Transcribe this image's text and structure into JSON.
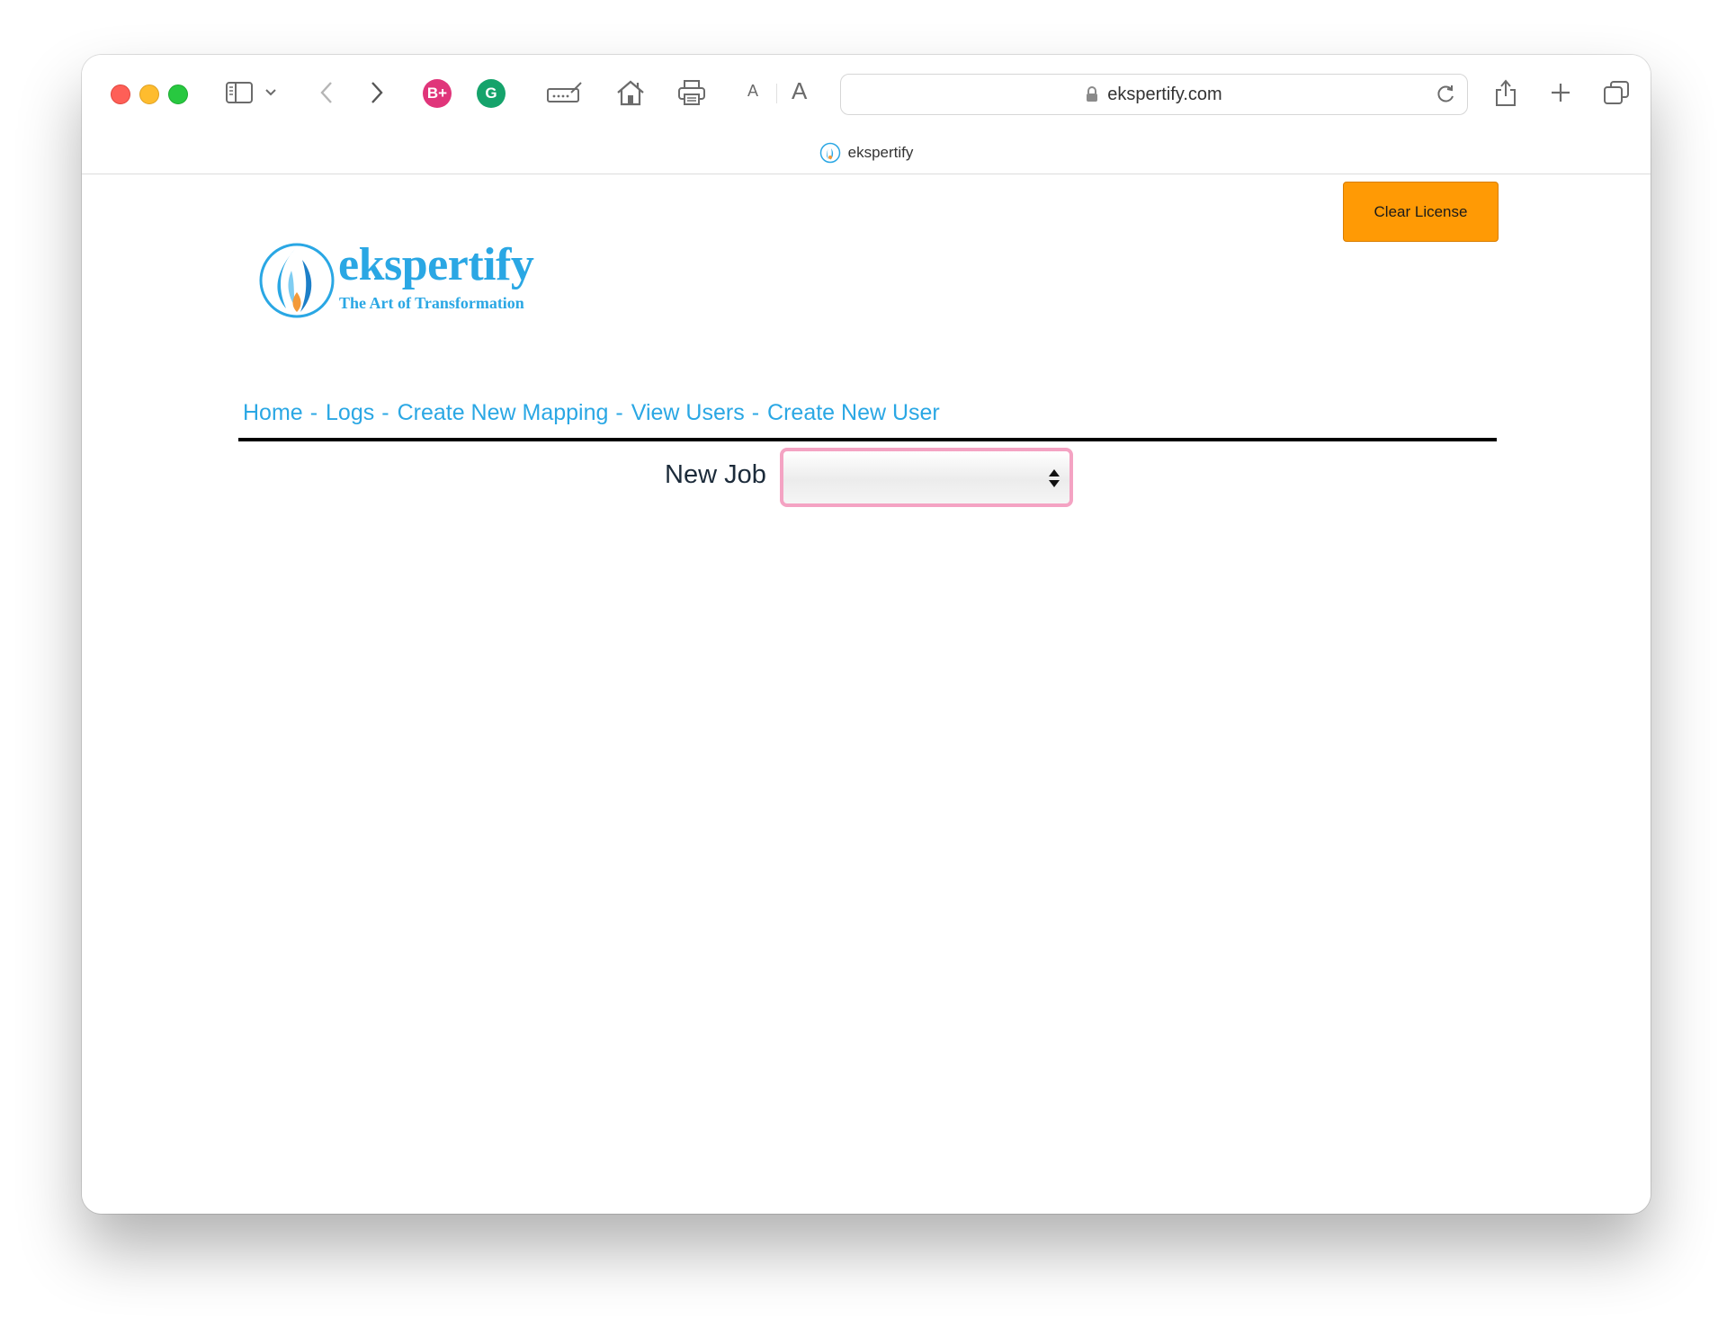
{
  "browser": {
    "url": "ekspertify.com",
    "tab_title": "ekspertify",
    "font_small_label": "A",
    "font_large_label": "A",
    "extensions": [
      {
        "name": "bplus-extension",
        "label": "B+",
        "color": "#e0357a"
      },
      {
        "name": "grammarly-extension",
        "label": "G",
        "color": "#15a36b"
      }
    ]
  },
  "page": {
    "clear_license_label": "Clear License",
    "logo": {
      "wordmark": "ekspertify",
      "tagline": "The Art of Transformation",
      "brand_color": "#2aa7e4",
      "flame_accent": "#f39a3a"
    },
    "nav": [
      {
        "label": "Home"
      },
      {
        "label": "Logs"
      },
      {
        "label": "Create New Mapping"
      },
      {
        "label": "View Users"
      },
      {
        "label": "Create New User"
      }
    ],
    "nav_separator": "-",
    "new_job": {
      "label": "New Job",
      "selected_value": ""
    },
    "colors": {
      "clear_license_bg": "#ff9a05",
      "link": "#2aa7e4",
      "select_focus_border": "#f4a3c3"
    }
  }
}
